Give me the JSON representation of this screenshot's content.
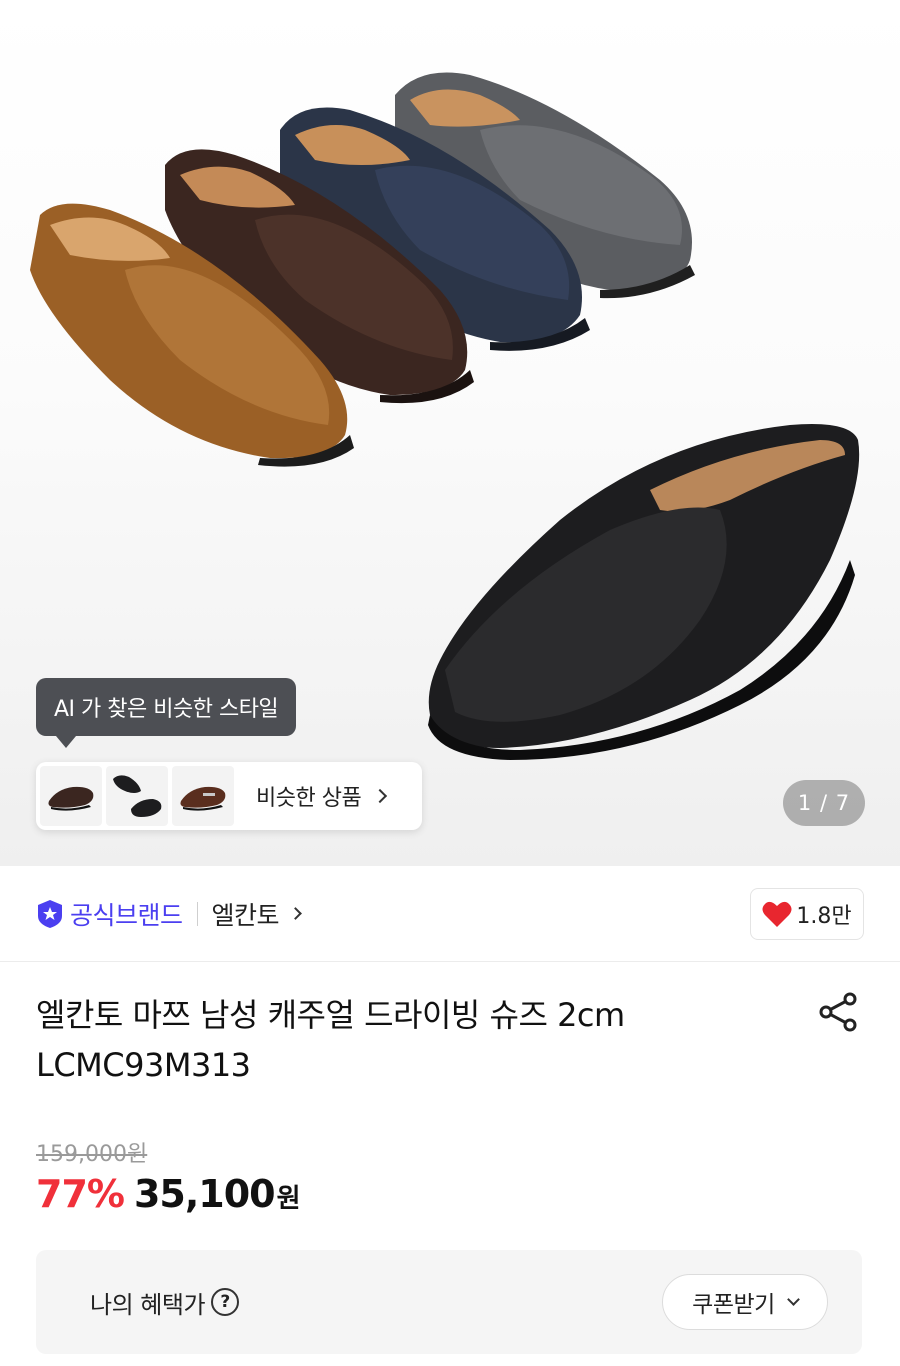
{
  "hero": {
    "tooltip": "AI 가 찾은 비슷한 스타일",
    "similar_label": "비슷한 상품",
    "pager": "1 / 7",
    "thumbnails": [
      "brown-loafer",
      "black-loafers-pair",
      "brown-bit-loafer"
    ]
  },
  "brand": {
    "official_label": "공식브랜드",
    "name": "엘칸토",
    "likes": "1.8만",
    "heart_color": "#e8262f",
    "official_color": "#4b3ff0"
  },
  "product": {
    "title": "엘칸토 마쯔 남성 캐주얼 드라이빙 슈즈 2cm LCMC93M313",
    "original_price": "159,000원",
    "discount": "77%",
    "price": "35,100",
    "currency": "원"
  },
  "benefit": {
    "label": "나의 혜택가",
    "help": "?",
    "coupon_button": "쿠폰받기"
  },
  "icons": {
    "share": "share-icon",
    "heart": "heart-icon",
    "badge": "official-badge-icon"
  }
}
